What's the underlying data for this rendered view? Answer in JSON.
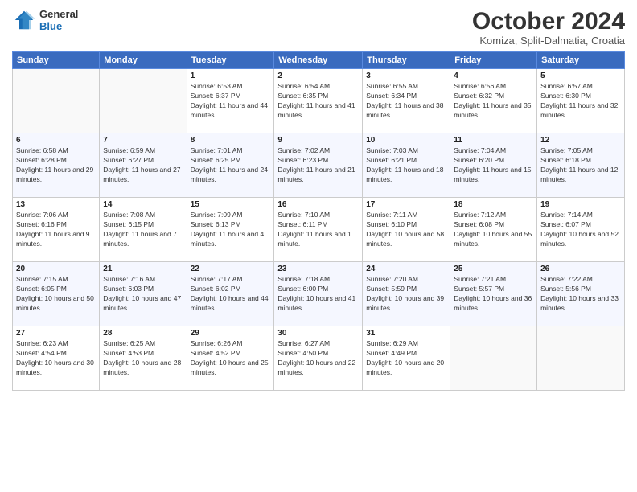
{
  "header": {
    "logo_general": "General",
    "logo_blue": "Blue",
    "month_title": "October 2024",
    "subtitle": "Komiza, Split-Dalmatia, Croatia"
  },
  "days_of_week": [
    "Sunday",
    "Monday",
    "Tuesday",
    "Wednesday",
    "Thursday",
    "Friday",
    "Saturday"
  ],
  "weeks": [
    [
      {
        "day": "",
        "sunrise": "",
        "sunset": "",
        "daylight": ""
      },
      {
        "day": "",
        "sunrise": "",
        "sunset": "",
        "daylight": ""
      },
      {
        "day": "1",
        "sunrise": "Sunrise: 6:53 AM",
        "sunset": "Sunset: 6:37 PM",
        "daylight": "Daylight: 11 hours and 44 minutes."
      },
      {
        "day": "2",
        "sunrise": "Sunrise: 6:54 AM",
        "sunset": "Sunset: 6:35 PM",
        "daylight": "Daylight: 11 hours and 41 minutes."
      },
      {
        "day": "3",
        "sunrise": "Sunrise: 6:55 AM",
        "sunset": "Sunset: 6:34 PM",
        "daylight": "Daylight: 11 hours and 38 minutes."
      },
      {
        "day": "4",
        "sunrise": "Sunrise: 6:56 AM",
        "sunset": "Sunset: 6:32 PM",
        "daylight": "Daylight: 11 hours and 35 minutes."
      },
      {
        "day": "5",
        "sunrise": "Sunrise: 6:57 AM",
        "sunset": "Sunset: 6:30 PM",
        "daylight": "Daylight: 11 hours and 32 minutes."
      }
    ],
    [
      {
        "day": "6",
        "sunrise": "Sunrise: 6:58 AM",
        "sunset": "Sunset: 6:28 PM",
        "daylight": "Daylight: 11 hours and 29 minutes."
      },
      {
        "day": "7",
        "sunrise": "Sunrise: 6:59 AM",
        "sunset": "Sunset: 6:27 PM",
        "daylight": "Daylight: 11 hours and 27 minutes."
      },
      {
        "day": "8",
        "sunrise": "Sunrise: 7:01 AM",
        "sunset": "Sunset: 6:25 PM",
        "daylight": "Daylight: 11 hours and 24 minutes."
      },
      {
        "day": "9",
        "sunrise": "Sunrise: 7:02 AM",
        "sunset": "Sunset: 6:23 PM",
        "daylight": "Daylight: 11 hours and 21 minutes."
      },
      {
        "day": "10",
        "sunrise": "Sunrise: 7:03 AM",
        "sunset": "Sunset: 6:21 PM",
        "daylight": "Daylight: 11 hours and 18 minutes."
      },
      {
        "day": "11",
        "sunrise": "Sunrise: 7:04 AM",
        "sunset": "Sunset: 6:20 PM",
        "daylight": "Daylight: 11 hours and 15 minutes."
      },
      {
        "day": "12",
        "sunrise": "Sunrise: 7:05 AM",
        "sunset": "Sunset: 6:18 PM",
        "daylight": "Daylight: 11 hours and 12 minutes."
      }
    ],
    [
      {
        "day": "13",
        "sunrise": "Sunrise: 7:06 AM",
        "sunset": "Sunset: 6:16 PM",
        "daylight": "Daylight: 11 hours and 9 minutes."
      },
      {
        "day": "14",
        "sunrise": "Sunrise: 7:08 AM",
        "sunset": "Sunset: 6:15 PM",
        "daylight": "Daylight: 11 hours and 7 minutes."
      },
      {
        "day": "15",
        "sunrise": "Sunrise: 7:09 AM",
        "sunset": "Sunset: 6:13 PM",
        "daylight": "Daylight: 11 hours and 4 minutes."
      },
      {
        "day": "16",
        "sunrise": "Sunrise: 7:10 AM",
        "sunset": "Sunset: 6:11 PM",
        "daylight": "Daylight: 11 hours and 1 minute."
      },
      {
        "day": "17",
        "sunrise": "Sunrise: 7:11 AM",
        "sunset": "Sunset: 6:10 PM",
        "daylight": "Daylight: 10 hours and 58 minutes."
      },
      {
        "day": "18",
        "sunrise": "Sunrise: 7:12 AM",
        "sunset": "Sunset: 6:08 PM",
        "daylight": "Daylight: 10 hours and 55 minutes."
      },
      {
        "day": "19",
        "sunrise": "Sunrise: 7:14 AM",
        "sunset": "Sunset: 6:07 PM",
        "daylight": "Daylight: 10 hours and 52 minutes."
      }
    ],
    [
      {
        "day": "20",
        "sunrise": "Sunrise: 7:15 AM",
        "sunset": "Sunset: 6:05 PM",
        "daylight": "Daylight: 10 hours and 50 minutes."
      },
      {
        "day": "21",
        "sunrise": "Sunrise: 7:16 AM",
        "sunset": "Sunset: 6:03 PM",
        "daylight": "Daylight: 10 hours and 47 minutes."
      },
      {
        "day": "22",
        "sunrise": "Sunrise: 7:17 AM",
        "sunset": "Sunset: 6:02 PM",
        "daylight": "Daylight: 10 hours and 44 minutes."
      },
      {
        "day": "23",
        "sunrise": "Sunrise: 7:18 AM",
        "sunset": "Sunset: 6:00 PM",
        "daylight": "Daylight: 10 hours and 41 minutes."
      },
      {
        "day": "24",
        "sunrise": "Sunrise: 7:20 AM",
        "sunset": "Sunset: 5:59 PM",
        "daylight": "Daylight: 10 hours and 39 minutes."
      },
      {
        "day": "25",
        "sunrise": "Sunrise: 7:21 AM",
        "sunset": "Sunset: 5:57 PM",
        "daylight": "Daylight: 10 hours and 36 minutes."
      },
      {
        "day": "26",
        "sunrise": "Sunrise: 7:22 AM",
        "sunset": "Sunset: 5:56 PM",
        "daylight": "Daylight: 10 hours and 33 minutes."
      }
    ],
    [
      {
        "day": "27",
        "sunrise": "Sunrise: 6:23 AM",
        "sunset": "Sunset: 4:54 PM",
        "daylight": "Daylight: 10 hours and 30 minutes."
      },
      {
        "day": "28",
        "sunrise": "Sunrise: 6:25 AM",
        "sunset": "Sunset: 4:53 PM",
        "daylight": "Daylight: 10 hours and 28 minutes."
      },
      {
        "day": "29",
        "sunrise": "Sunrise: 6:26 AM",
        "sunset": "Sunset: 4:52 PM",
        "daylight": "Daylight: 10 hours and 25 minutes."
      },
      {
        "day": "30",
        "sunrise": "Sunrise: 6:27 AM",
        "sunset": "Sunset: 4:50 PM",
        "daylight": "Daylight: 10 hours and 22 minutes."
      },
      {
        "day": "31",
        "sunrise": "Sunrise: 6:29 AM",
        "sunset": "Sunset: 4:49 PM",
        "daylight": "Daylight: 10 hours and 20 minutes."
      },
      {
        "day": "",
        "sunrise": "",
        "sunset": "",
        "daylight": ""
      },
      {
        "day": "",
        "sunrise": "",
        "sunset": "",
        "daylight": ""
      }
    ]
  ]
}
